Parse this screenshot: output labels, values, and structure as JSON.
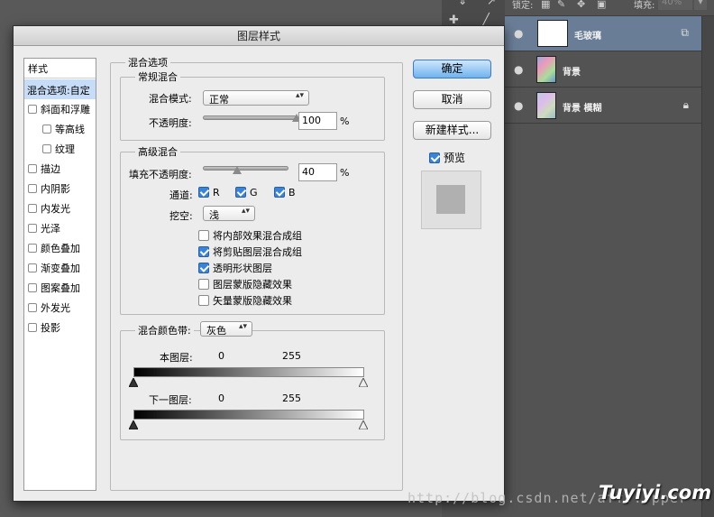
{
  "app": {
    "toolbar": {
      "lock_label": "锁定:",
      "fill_label": "填充:",
      "fill_value": "40%"
    },
    "layers": [
      {
        "name": "毛玻璃",
        "selected": true,
        "badge": "smart-object-icon"
      },
      {
        "name": "背景",
        "selected": false,
        "badge": ""
      },
      {
        "name": "背景 模糊",
        "selected": false,
        "badge": "lock-icon"
      }
    ]
  },
  "dialog": {
    "title": "图层样式",
    "styles_list": {
      "header": "样式",
      "active": "混合选项:自定",
      "items": [
        {
          "label": "斜面和浮雕",
          "indent": false
        },
        {
          "label": "等高线",
          "indent": true
        },
        {
          "label": "纹理",
          "indent": true
        },
        {
          "label": "描边",
          "indent": false
        },
        {
          "label": "内阴影",
          "indent": false
        },
        {
          "label": "内发光",
          "indent": false
        },
        {
          "label": "光泽",
          "indent": false
        },
        {
          "label": "颜色叠加",
          "indent": false
        },
        {
          "label": "渐变叠加",
          "indent": false
        },
        {
          "label": "图案叠加",
          "indent": false
        },
        {
          "label": "外发光",
          "indent": false
        },
        {
          "label": "投影",
          "indent": false
        }
      ]
    },
    "blend_options": {
      "title": "混合选项",
      "general": {
        "title": "常规混合",
        "mode_label": "混合模式:",
        "mode_value": "正常",
        "opacity_label": "不透明度:",
        "opacity_value": "100",
        "opacity_unit": "%",
        "opacity_level": 1.0
      },
      "advanced": {
        "title": "高级混合",
        "fill_label": "填充不透明度:",
        "fill_value": "40",
        "fill_unit": "%",
        "fill_level": 0.4,
        "channels_label": "通道:",
        "channels": [
          {
            "label": "R",
            "checked": true
          },
          {
            "label": "G",
            "checked": true
          },
          {
            "label": "B",
            "checked": true
          }
        ],
        "knockout_label": "挖空:",
        "knockout_value": "浅",
        "options": [
          {
            "label": "将内部效果混合成组",
            "checked": false
          },
          {
            "label": "将剪贴图层混合成组",
            "checked": true
          },
          {
            "label": "透明形状图层",
            "checked": true
          },
          {
            "label": "图层蒙版隐藏效果",
            "checked": false
          },
          {
            "label": "矢量蒙版隐藏效果",
            "checked": false
          }
        ]
      },
      "blend_if": {
        "label": "混合颜色带:",
        "value": "灰色",
        "this_layer_label": "本图层:",
        "this_layer_min": "0",
        "this_layer_max": "255",
        "underlying_label": "下一图层:",
        "underlying_min": "0",
        "underlying_max": "255"
      }
    },
    "buttons": {
      "ok": "确定",
      "cancel": "取消",
      "new_style": "新建样式...",
      "preview_label": "预览",
      "preview_checked": true
    }
  },
  "watermark": {
    "url": "http://blog.csdn.net/aff...pper",
    "brand": "Tuyiyi.com"
  }
}
